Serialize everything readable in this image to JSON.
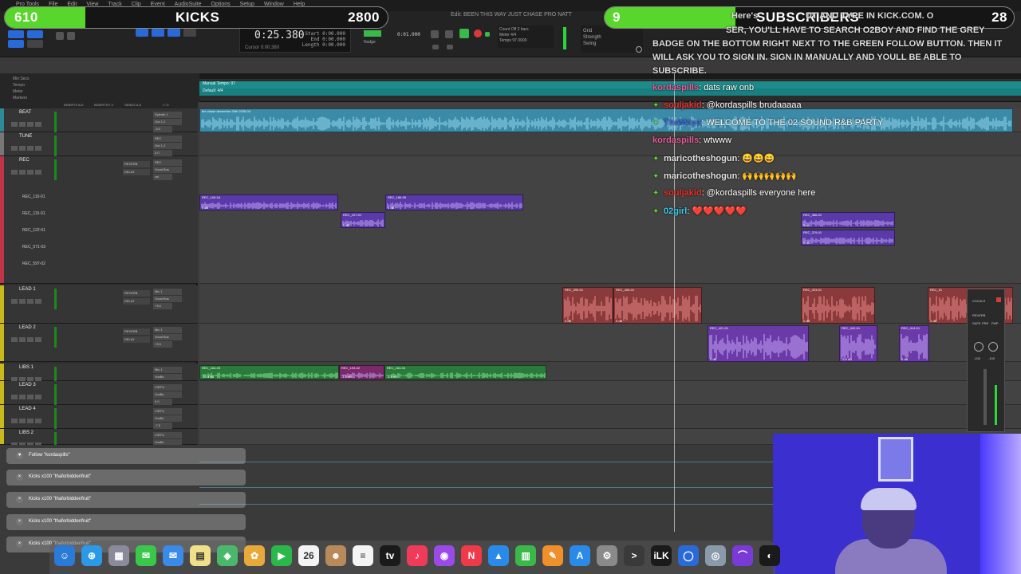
{
  "menubar": [
    "Pro Tools",
    "File",
    "Edit",
    "View",
    "Track",
    "Clip",
    "Event",
    "AudioSuite",
    "Options",
    "Setup",
    "Window",
    "Help"
  ],
  "session_title": "Edit: BEEN THIS WAY JUST CHASE PRO NATT",
  "counter": {
    "main": "0:25.380",
    "start_label": "Start",
    "end_label": "End",
    "length_label": "Length",
    "start": "0:00.000",
    "end": "0:00.000",
    "length": "0:00.000",
    "cursor_label": "Cursor",
    "cursor": "0:00.380",
    "nudge_label": "Nudge",
    "nudge": "0:01.000"
  },
  "transport": {
    "count_off": "Count Off",
    "meter_label": "Meter",
    "meter": "4/4",
    "tempo_label": "Tempo",
    "tempo": "97.0000",
    "bars": "2 bars"
  },
  "grid": {
    "grid_label": "Grid",
    "strength_label": "Strength",
    "swing_label": "Swing"
  },
  "stats": {
    "kicks_left": "610",
    "kicks_label": "KICKS",
    "kicks_goal": "2800",
    "kicks_progress": 0.21,
    "subs_left": "9",
    "subs_label": "SUBSCRIBERS",
    "subs_goal": "28",
    "subs_progress": 0.32
  },
  "rulers": [
    "Min:Secs",
    "Tempo",
    "Meter",
    "Markers"
  ],
  "tempo_label": "Manual Tempo: 97",
  "meter_label": "Default: 4/4",
  "columns": [
    "INSERTS A-E",
    "INSERTS F-J",
    "SENDS A-E",
    "I / O"
  ],
  "tracks": [
    {
      "name": "BEAT",
      "io_in": "Sylenth 1",
      "io_out": "Out 1-2",
      "vol": "-3.0",
      "color": "#2e8a9a"
    },
    {
      "name": "TUNE",
      "io_in": "REC",
      "io_out": "Out 1-2",
      "vol": "0.0",
      "color": "#777777"
    },
    {
      "name": "REC",
      "io_in": "REC",
      "io_out": "Vocal Bus",
      "vol": "vol",
      "color": "#c0344a",
      "sends": [
        "REVERB",
        "DELAY"
      ],
      "subs": [
        "REC_110-01",
        "REC_115-01",
        "REC_122-01",
        "REC_571-03",
        "REC_597-02"
      ]
    },
    {
      "name": "LEAD 1",
      "io_in": "Mic 1",
      "io_out": "Vocal Bus",
      "vol": "+3.0",
      "color": "#c9b81a",
      "sends": [
        "REVERB",
        "DELAY"
      ]
    },
    {
      "name": "LEAD 2",
      "io_in": "Mic 1",
      "io_out": "Vocal Bus",
      "vol": "+3.0",
      "color": "#c9b81a",
      "sends": [
        "REVERB",
        "DELAY"
      ]
    },
    {
      "name": "LIBS 1",
      "io_in": "Mic 1",
      "io_out": "VoxBs",
      "vol": "-7.5",
      "color": "#c9b81a"
    },
    {
      "name": "LEAD 3",
      "io_in": "VIRTU",
      "io_out": "VoxBs",
      "vol": "0.0",
      "color": "#c9b81a"
    },
    {
      "name": "LEAD 4",
      "io_in": "VIRTU",
      "io_out": "VoxBs",
      "vol": "-7.5",
      "color": "#c9b81a"
    },
    {
      "name": "LIBS 2",
      "io_in": "VIRTU",
      "io_out": "VoxBs",
      "vol": "-7.5",
      "color": "#c9b81a"
    }
  ],
  "clips": [
    {
      "name": "the chase december 26th 2025-04",
      "gain": "",
      "color": "#3a8aa8"
    },
    {
      "name": "REC_106-04",
      "gain": "0 dB",
      "color": "#5a3aa8"
    },
    {
      "name": "REC_197-01",
      "gain": "0 dB",
      "color": "#5a3aa8"
    },
    {
      "name": "REC_186-05",
      "gain": "0 dB",
      "color": "#5a3aa8"
    },
    {
      "name": "REC_386-01",
      "gain": "0 dB",
      "color": "#5a3aa8"
    },
    {
      "name": "REC_379-01",
      "gain": "0 dB",
      "color": "#5a3aa8"
    },
    {
      "name": "REC_399-01",
      "gain": "0 dB",
      "color": "#8a3a3a"
    },
    {
      "name": "REC_406-01",
      "gain": "0 dB",
      "color": "#8a3a3a"
    },
    {
      "name": "REC_423-01",
      "gain": "0 dB",
      "color": "#8a3a3a"
    },
    {
      "name": "REC_51",
      "gain": "0 dB",
      "color": "#8a3a3a"
    },
    {
      "name": "REC_421-01",
      "gain": "0 dB",
      "color": "#6a3aa8"
    },
    {
      "name": "REC_442-01",
      "gain": "-5.6 dB",
      "color": "#6a3aa8"
    },
    {
      "name": "REC_414-01",
      "gain": "0 dB",
      "color": "#6a3aa8"
    },
    {
      "name": "REC_184-03",
      "gain": "-10.3 dB",
      "color": "#2a7a3a"
    },
    {
      "name": "REC_193-02",
      "gain": "-1.8 dB",
      "color": "#7a2a6a"
    },
    {
      "name": "REC_164-04",
      "gain": "-4.6 dB",
      "color": "#2a7a3a"
    }
  ],
  "announcement": "Here's how to subscribe: [hidden] USER, YOU'LL HAVE TO SEARCH O2BOY AND FIND THE GREY BADGE ON THE BOTTOM RIGHT NEXT TO THE GREEN FOLLOW BUTTON. THEN IT WILL ASK YOU TO SIGN IN. SIGN IN MANUALLY AND YOULL BE ABLE TO SUBSCRIBE.",
  "announcement_visible_1": "Here's",
  "announcement_visible_2": "SER, YOU'LL HAVE TO SEARCH O2BOY AND FIND THE GREY",
  "announcement_visible_3": "BADGE ON THE BOTTOM RIGHT NEXT TO THE GREEN FOLLOW BUTTON. THEN IT",
  "announcement_visible_4": "WILL ASK YOU TO SIGN IN. SIGN IN MANUALLY AND YOULL BE ABLE TO",
  "announcement_visible_5": "SUBSCRIBE.",
  "announcement_top": "UT AND TYPE IN KICK.COM. O",
  "chat": [
    {
      "user": "kordaspills",
      "text": ": dats raw onb",
      "color": "#e85a9a",
      "badge": false
    },
    {
      "user": "souljakid",
      "text": ": @kordaspills brudaaaaa",
      "color": "#e8302a",
      "badge": true
    },
    {
      "user": "TheMaya",
      "text": ": WELCOME TO THE 02 SOUND R&B PARTY",
      "color": "#3a6ad8",
      "badge": true
    },
    {
      "user": "kordaspills",
      "text": ": wtwww",
      "color": "#e85a9a",
      "badge": false
    },
    {
      "user": "maricotheshogun",
      "text": ": 😄😄😄",
      "color": "#e0e0e0",
      "badge": true
    },
    {
      "user": "maricotheshogun",
      "text": ": 🙌🙌🙌🙌🙌",
      "color": "#e0e0e0",
      "badge": true
    },
    {
      "user": "souljakid",
      "text": ": @kordaspills everyone here",
      "color": "#e8302a",
      "badge": true
    },
    {
      "user": "02girl",
      "text": ": ❤️❤️❤️❤️❤️",
      "color": "#3ac8e8",
      "badge": true
    }
  ],
  "alerts": [
    {
      "text": "Follow \"kordaspills\"",
      "icon": "heart-icon"
    },
    {
      "text": "Kicks x100 \"thaforbiddenfruit\"",
      "icon": "close-icon"
    },
    {
      "text": "Kicks x100 \"thaforbiddenfruit\"",
      "icon": "close-icon"
    },
    {
      "text": "Kicks x100 \"thaforbiddenfruit\"",
      "icon": "close-icon"
    },
    {
      "text": "Kicks x100 \"thaforbiddenfruit\"",
      "icon": "close-icon"
    }
  ],
  "mixer": {
    "label": "VOCALS",
    "send": "REVERB",
    "safe": "SAFE",
    "pre": "PRE",
    "fmp": "FMP",
    "vol": "-100",
    "out": "-100"
  },
  "dock": [
    {
      "name": "finder-icon",
      "color": "#2a7ad8",
      "glyph": "☺"
    },
    {
      "name": "safari-icon",
      "color": "#2a9ae8",
      "glyph": "⊕"
    },
    {
      "name": "launchpad-icon",
      "color": "#8a8a9a",
      "glyph": "▦"
    },
    {
      "name": "messages-icon",
      "color": "#3ac84a",
      "glyph": "✉"
    },
    {
      "name": "mail-icon",
      "color": "#3a8ae8",
      "glyph": "✉"
    },
    {
      "name": "notes-icon",
      "color": "#f0e08a",
      "glyph": "▤"
    },
    {
      "name": "maps-icon",
      "color": "#4ab86a",
      "glyph": "◈"
    },
    {
      "name": "photos-icon",
      "color": "#e8a83a",
      "glyph": "✿"
    },
    {
      "name": "facetime-icon",
      "color": "#2ab84a",
      "glyph": "▶"
    },
    {
      "name": "calendar-icon",
      "color": "#f4f4f4",
      "glyph": "26"
    },
    {
      "name": "contacts-icon",
      "color": "#b88a5a",
      "glyph": "☻"
    },
    {
      "name": "reminders-icon",
      "color": "#f4f4f4",
      "glyph": "≡"
    },
    {
      "name": "appletv-icon",
      "color": "#1a1a1a",
      "glyph": "tv"
    },
    {
      "name": "music-icon",
      "color": "#f03a5a",
      "glyph": "♪"
    },
    {
      "name": "podcasts-icon",
      "color": "#9a4ae8",
      "glyph": "◉"
    },
    {
      "name": "news-icon",
      "color": "#f03a4a",
      "glyph": "N"
    },
    {
      "name": "keynote-icon",
      "color": "#2a8ae8",
      "glyph": "▲"
    },
    {
      "name": "numbers-icon",
      "color": "#3ab84a",
      "glyph": "▥"
    },
    {
      "name": "pages-icon",
      "color": "#f0902a",
      "glyph": "✎"
    },
    {
      "name": "appstore-icon",
      "color": "#2a8ae8",
      "glyph": "A"
    },
    {
      "name": "settings-icon",
      "color": "#8a8a8a",
      "glyph": "⚙"
    },
    {
      "name": "terminal-icon",
      "color": "#3a3a3a",
      "glyph": ">"
    },
    {
      "name": "ilok-icon",
      "color": "#1a1a1a",
      "glyph": "iLK"
    },
    {
      "name": "browser-icon",
      "color": "#2a6ad8",
      "glyph": "◯"
    },
    {
      "name": "disk-icon",
      "color": "#8a9aaa",
      "glyph": "◎"
    },
    {
      "name": "avid-icon",
      "color": "#7a3ad8",
      "glyph": "⌒"
    },
    {
      "name": "protools-icon",
      "color": "#1a1a1a",
      "glyph": "◐"
    }
  ]
}
